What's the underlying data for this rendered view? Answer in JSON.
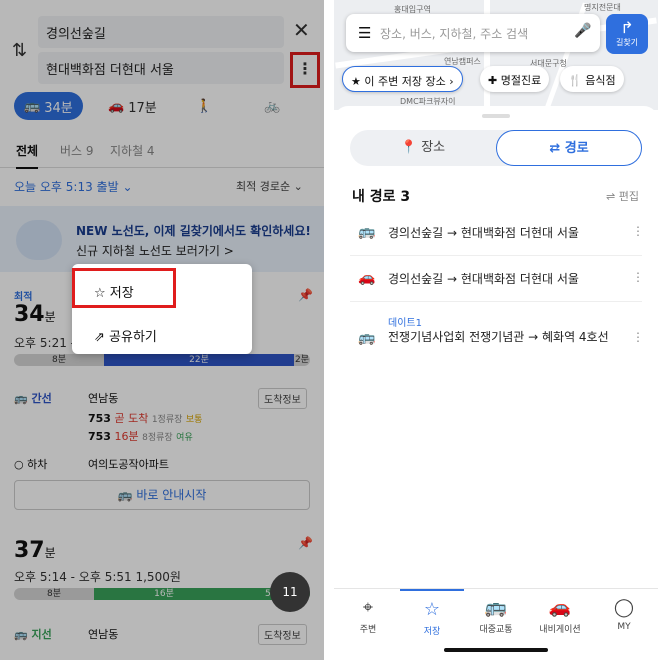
{
  "left": {
    "origin": "경의선숲길",
    "destination": "현대백화점 더현대 서울",
    "modes": [
      {
        "icon": "bus-icon",
        "label": "34분"
      },
      {
        "icon": "car-icon",
        "label": "17분"
      },
      {
        "icon": "walk-icon",
        "label": ""
      },
      {
        "icon": "bike-icon",
        "label": ""
      }
    ],
    "filter_tabs": [
      "전체",
      "버스 9",
      "지하철 4"
    ],
    "depart": "오늘 오후 5:13 출발",
    "sort": "최적 경로순",
    "banner": {
      "line1": "NEW 노선도, 이제 길찾기에서도 확인하세요!",
      "line2": "신규 지하철 노선도 보러가기 >"
    },
    "route1": {
      "badge": "최적",
      "minutes": "34",
      "unit": "분",
      "time_range": "오후 5:21 -",
      "segments": [
        "8분",
        "22분",
        "2분"
      ],
      "type_label": "간선",
      "board_stop": "연남동",
      "info_button": "도착정보",
      "buses": [
        {
          "number": "753",
          "status": "곧 도착",
          "detail": "1정류장",
          "tag": "보통"
        },
        {
          "number": "753",
          "status": "16분",
          "detail": "8정류장",
          "tag": "여유"
        }
      ],
      "alight_label": "하차",
      "alight_stop": "여의도공작아파트",
      "guide_button": "바로 안내시작"
    },
    "route2": {
      "minutes": "37",
      "unit": "분",
      "time_range": "오후 5:14 - 오후 5:51",
      "fare": "1,500원",
      "segments": [
        "8분",
        "16분",
        "5분"
      ],
      "type_label": "지선",
      "board_stop": "연남동",
      "info_button": "도착정보"
    },
    "menu": {
      "save": "저장",
      "share": "공유하기"
    },
    "fab_label": "11"
  },
  "right": {
    "search_placeholder": "장소, 버스, 지하철, 주소 검색",
    "nav_button": "길찾기",
    "map_labels": [
      "명지전문대",
      "홍대입구역",
      "연남캠퍼스",
      "서대문구청",
      "DMC파크뷰자이"
    ],
    "chips": [
      "이 주변 저장 장소",
      "명절진료",
      "음식점"
    ],
    "tabs": [
      "장소",
      "경로"
    ],
    "my_routes_title": "내 경로 3",
    "edit_label": "편집",
    "routes": [
      {
        "icon": "bus-icon",
        "from": "경의선숲길",
        "to": "현대백화점 더현대 서울",
        "tag": ""
      },
      {
        "icon": "car-icon",
        "from": "경의선숲길",
        "to": "현대백화점 더현대 서울",
        "tag": ""
      },
      {
        "icon": "bus-icon",
        "from": "전쟁기념사업회 전쟁기념관",
        "to": "혜화역 4호선",
        "tag": "데이트1"
      }
    ],
    "bottom_nav": [
      "주변",
      "저장",
      "대중교통",
      "내비게이션",
      "MY"
    ]
  }
}
